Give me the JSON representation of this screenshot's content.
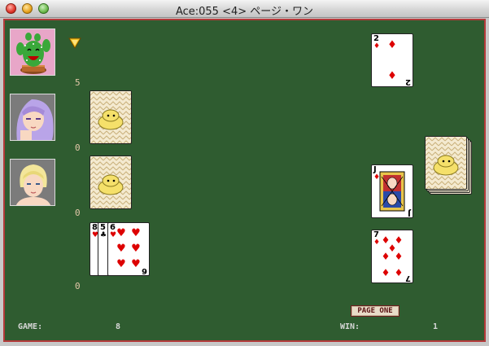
{
  "window": {
    "title": "Ace:055 <4> ページ・ワン"
  },
  "players": [
    {
      "id": "player-cactus",
      "count": "5"
    },
    {
      "id": "player-purple-hair",
      "count": "0"
    },
    {
      "id": "player-blonde",
      "count": "0"
    },
    {
      "id": "player-self",
      "count": "0"
    }
  ],
  "hand": [
    {
      "rank": "8",
      "suit": "♥"
    },
    {
      "rank": "5",
      "suit": "♣"
    },
    {
      "rank": "6",
      "suit": "♥"
    }
  ],
  "table_cards": [
    {
      "rank": "2",
      "suit": "♦"
    },
    {
      "rank": "J",
      "suit": "♦"
    },
    {
      "rank": "7",
      "suit": "♦"
    }
  ],
  "status": {
    "page_one_label": "PAGE ONE",
    "game_label": "GAME:",
    "game_value": "8",
    "win_label": "WIN:",
    "win_value": "1"
  },
  "colors": {
    "felt": "#2f5c30",
    "border": "#b33a3a",
    "red_suit": "#dd0000"
  }
}
